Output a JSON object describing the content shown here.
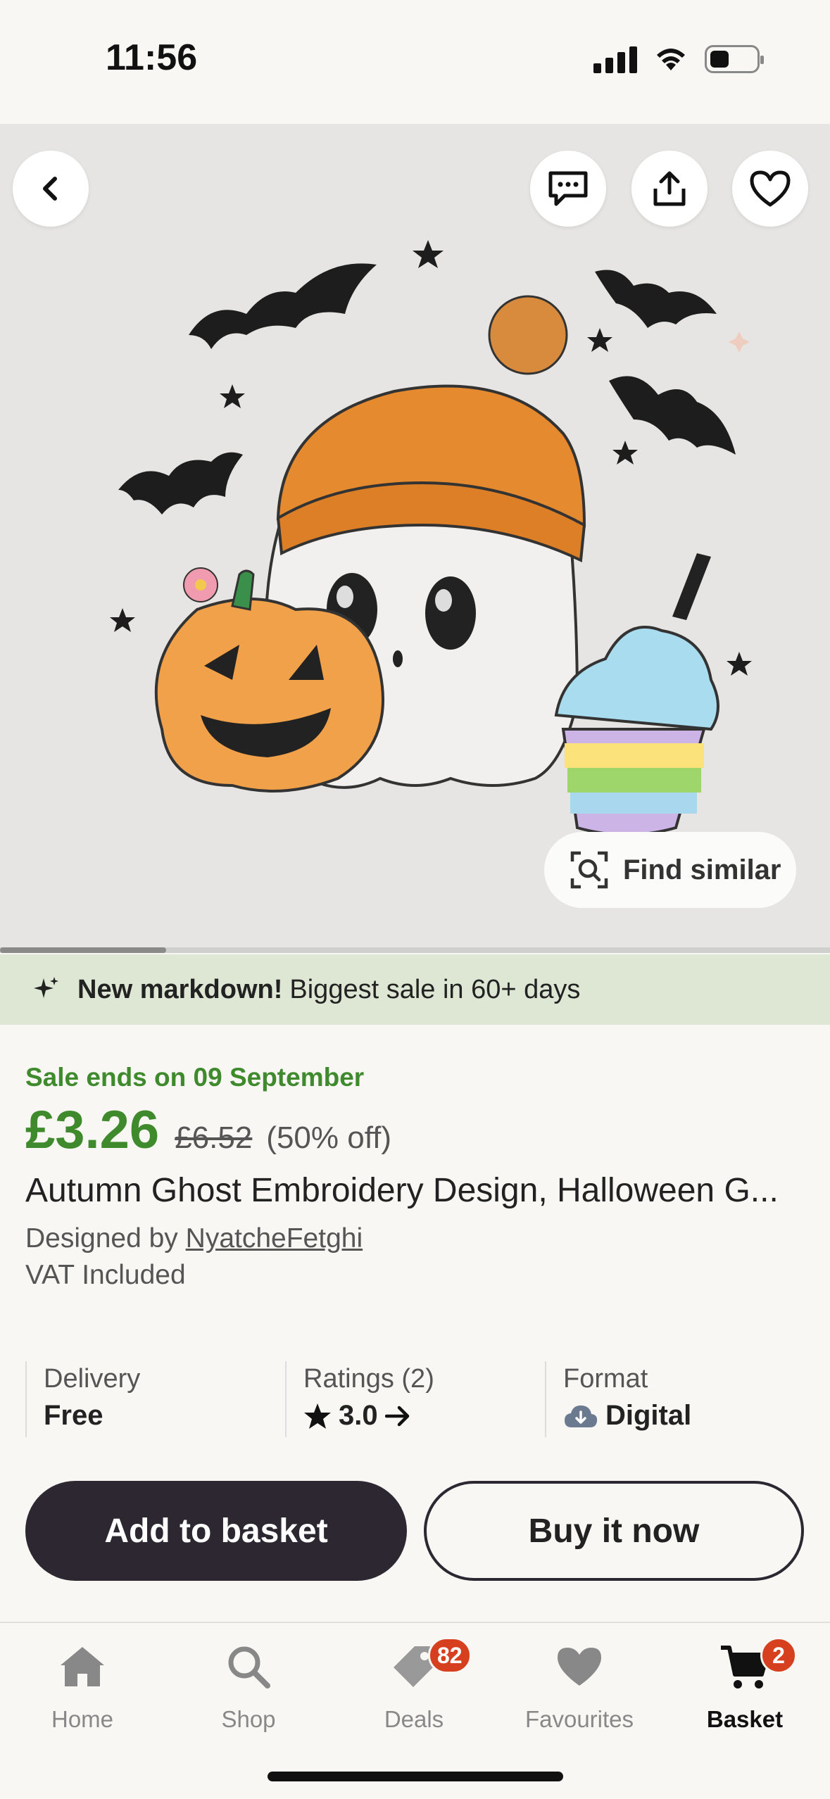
{
  "status_bar": {
    "time": "11:56"
  },
  "hero": {
    "actions": {
      "back": "back-icon",
      "message": "message-icon",
      "share": "share-icon",
      "favourite": "heart-icon"
    },
    "find_similar_label": "Find similar",
    "image_index": 1
  },
  "banner": {
    "bold": "New markdown!",
    "text": "Biggest sale in 60+ days"
  },
  "product": {
    "sale_ends": "Sale ends on 09 September",
    "price_now": "£3.26",
    "price_was": "£6.52",
    "discount": "(50% off)",
    "title": "Autumn Ghost Embroidery Design, Halloween G...",
    "designed_by_prefix": "Designed by",
    "designer": "NyatcheFetghi",
    "vat": "VAT Included"
  },
  "info": {
    "delivery_label": "Delivery",
    "delivery_value": "Free",
    "ratings_label": "Ratings (2)",
    "ratings_value": "3.0",
    "format_label": "Format",
    "format_value": "Digital"
  },
  "buttons": {
    "add_to_basket": "Add to basket",
    "buy_now": "Buy it now"
  },
  "tabs": [
    {
      "label": "Home"
    },
    {
      "label": "Shop"
    },
    {
      "label": "Deals",
      "badge": "82"
    },
    {
      "label": "Favourites"
    },
    {
      "label": "Basket",
      "badge": "2",
      "active": true
    }
  ],
  "colors": {
    "sale_green": "#3f8a2d",
    "banner_bg": "#dde7d3",
    "primary_dark": "#2c2730",
    "badge_red": "#d6401f"
  }
}
